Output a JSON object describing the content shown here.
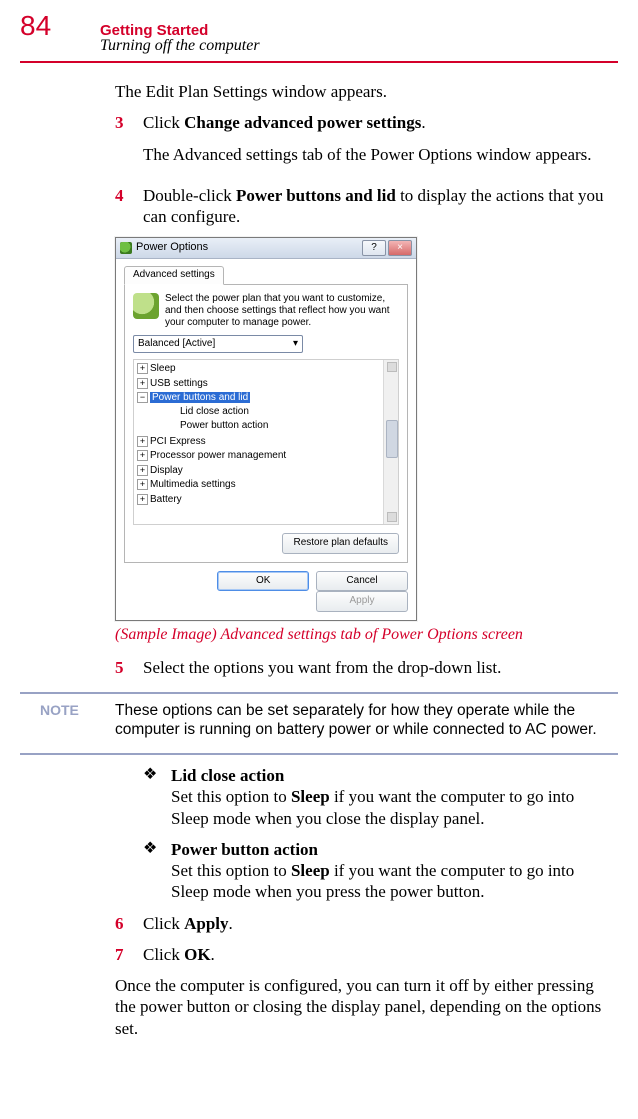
{
  "page_number": "84",
  "chapter": "Getting Started",
  "section": "Turning off the computer",
  "intro_line": "The Edit Plan Settings window appears.",
  "steps": {
    "s3": {
      "num": "3",
      "pre": "Click ",
      "bold": "Change advanced power settings",
      "post": ".",
      "follow": "The Advanced settings tab of the Power Options window appears."
    },
    "s4": {
      "num": "4",
      "pre": "Double-click ",
      "bold": "Power buttons and lid",
      "post": " to display the actions that you can configure."
    },
    "s5": {
      "num": "5",
      "text": "Select the options you want from the drop-down list."
    },
    "s6": {
      "num": "6",
      "pre": "Click ",
      "bold": "Apply",
      "post": "."
    },
    "s7": {
      "num": "7",
      "pre": "Click ",
      "bold": "OK",
      "post": "."
    }
  },
  "caption": "(Sample Image) Advanced settings tab of Power Options screen",
  "note_label": "NOTE",
  "note_text": "These options can be set separately for how they operate while the computer is running on battery power or while connected to AC power.",
  "bullets": {
    "lid": {
      "title": "Lid close action",
      "pre": "Set this option to ",
      "bold": "Sleep",
      "post": " if you want the computer to go into Sleep mode when you close the display panel."
    },
    "pwr": {
      "title": "Power button action",
      "pre": "Set this option to ",
      "bold": "Sleep",
      "post": " if you want the computer to go into Sleep mode when you press the power button."
    }
  },
  "closing": "Once the computer is configured, you can turn it off by either pressing the power button or closing the display panel, depending on the options set.",
  "bullet_mark": "❖",
  "window": {
    "title": "Power Options",
    "help": "?",
    "close": "×",
    "tab": "Advanced settings",
    "desc": "Select the power plan that you want to customize, and then choose settings that reflect how you want your computer to manage power.",
    "plan": "Balanced [Active]",
    "dd_arrow": "▾",
    "tree": {
      "sleep": "Sleep",
      "usb": "USB settings",
      "pbl": "Power buttons and lid",
      "lid": "Lid close action",
      "pba": "Power button action",
      "pci": "PCI Express",
      "ppm": "Processor power management",
      "display": "Display",
      "mm": "Multimedia settings",
      "battery": "Battery"
    },
    "restore": "Restore plan defaults",
    "ok": "OK",
    "cancel": "Cancel",
    "apply": "Apply"
  }
}
